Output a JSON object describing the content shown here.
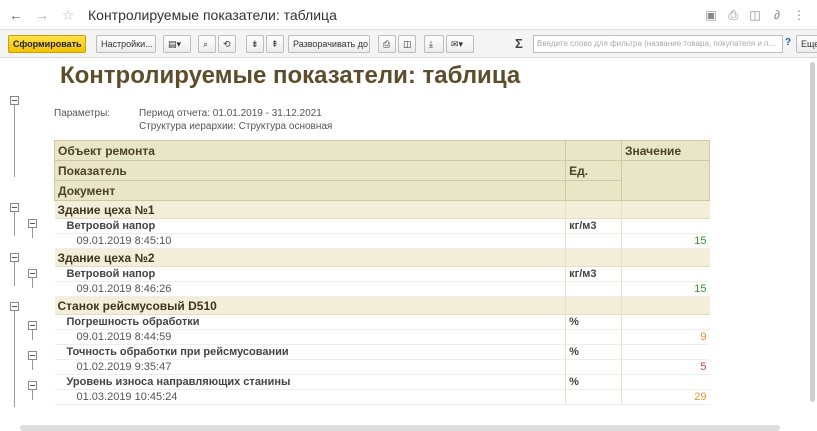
{
  "window": {
    "title": "Контролируемые показатели: таблица"
  },
  "toolbar": {
    "generate_label": "Сформировать",
    "settings_label": "Настройки...",
    "expand_label": "Разворачивать до",
    "sigma": "Σ",
    "search_placeholder": "Введите слово для фильтра (название товара, покупателя и п...",
    "help": "?",
    "more_label": "Еще"
  },
  "report": {
    "title": "Контролируемые показатели: таблица",
    "params_label": "Параметры:",
    "period": "Период отчета: 01.01.2019 - 31.12.2021",
    "hierarchy": "Структура иерархии: Структура основная"
  },
  "table": {
    "header": {
      "object": "Объект ремонта",
      "indicator": "Показатель",
      "document": "Документ",
      "unit": "Ед.",
      "value": "Значение"
    },
    "groups": [
      {
        "name": "Здание цеха №1",
        "rows": [
          {
            "indicator": "Ветровой напор",
            "unit": "кг/м3",
            "date": "09.01.2019 8:45:10",
            "value": "15",
            "color": "#2e9a2e"
          }
        ]
      },
      {
        "name": "Здание цеха №2",
        "rows": [
          {
            "indicator": "Ветровой напор",
            "unit": "кг/м3",
            "date": "09.01.2019 8:46:26",
            "value": "15",
            "color": "#2e9a2e"
          }
        ]
      },
      {
        "name": "Станок рейсмусовый D510",
        "rows": [
          {
            "indicator": "Погрешность обработки",
            "unit": "%",
            "date": "09.01.2019 8:44:59",
            "value": "9",
            "color": "#e08a2e"
          },
          {
            "indicator": "Точность обработки при рейсмусовании",
            "unit": "%",
            "date": "01.02.2019 9:35:47",
            "value": "5",
            "color": "#d23a3a"
          },
          {
            "indicator": "Уровень износа направляющих станины",
            "unit": "%",
            "date": "01.03.2019 10:45:24",
            "value": "29",
            "color": "#e09a2e"
          }
        ]
      }
    ]
  }
}
